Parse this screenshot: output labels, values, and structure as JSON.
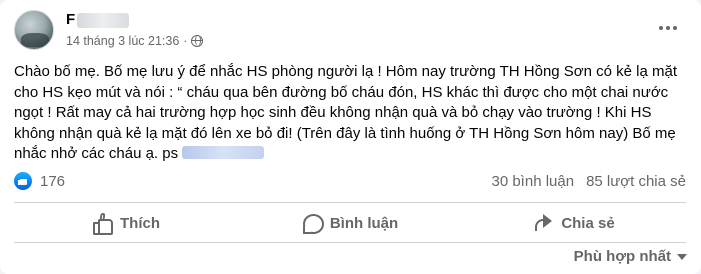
{
  "post": {
    "author": "F",
    "timestamp": "14 tháng 3 lúc 21:36",
    "separator": "·",
    "privacy_icon": "globe-icon",
    "body_lines": [
      "Chào bố mẹ. Bố mẹ lưu ý để nhắc HS phòng người lạ ! Hôm nay trường TH Hồng Sơn có kẻ lạ mặt",
      "cho HS kẹo mút và nói : “ cháu qua bên đường bố cháu đón, HS khác thì được cho một chai nước",
      "ngọt ! Rất may cả hai trường hợp học sinh đều không nhận quà và bỏ chạy vào trường ! Khi HS",
      "không nhận quà kẻ lạ mặt đó lên xe bỏ đi! (Trên đây là tình huống ở TH Hồng Sơn hôm nay) Bố mẹ",
      "nhắc nhở các cháu ạ. ps"
    ]
  },
  "stats": {
    "reactions": "176",
    "comments": "30 bình luận",
    "shares": "85 lượt chia sẻ"
  },
  "actions": {
    "like": "Thích",
    "comment": "Bình luận",
    "share": "Chia sẻ"
  },
  "comments_sort": {
    "label": "Phù hợp nhất"
  },
  "colors": {
    "text_primary": "#050505",
    "text_secondary": "#65676b",
    "like_blue": "#1877f2",
    "divider": "#ced0d4"
  }
}
